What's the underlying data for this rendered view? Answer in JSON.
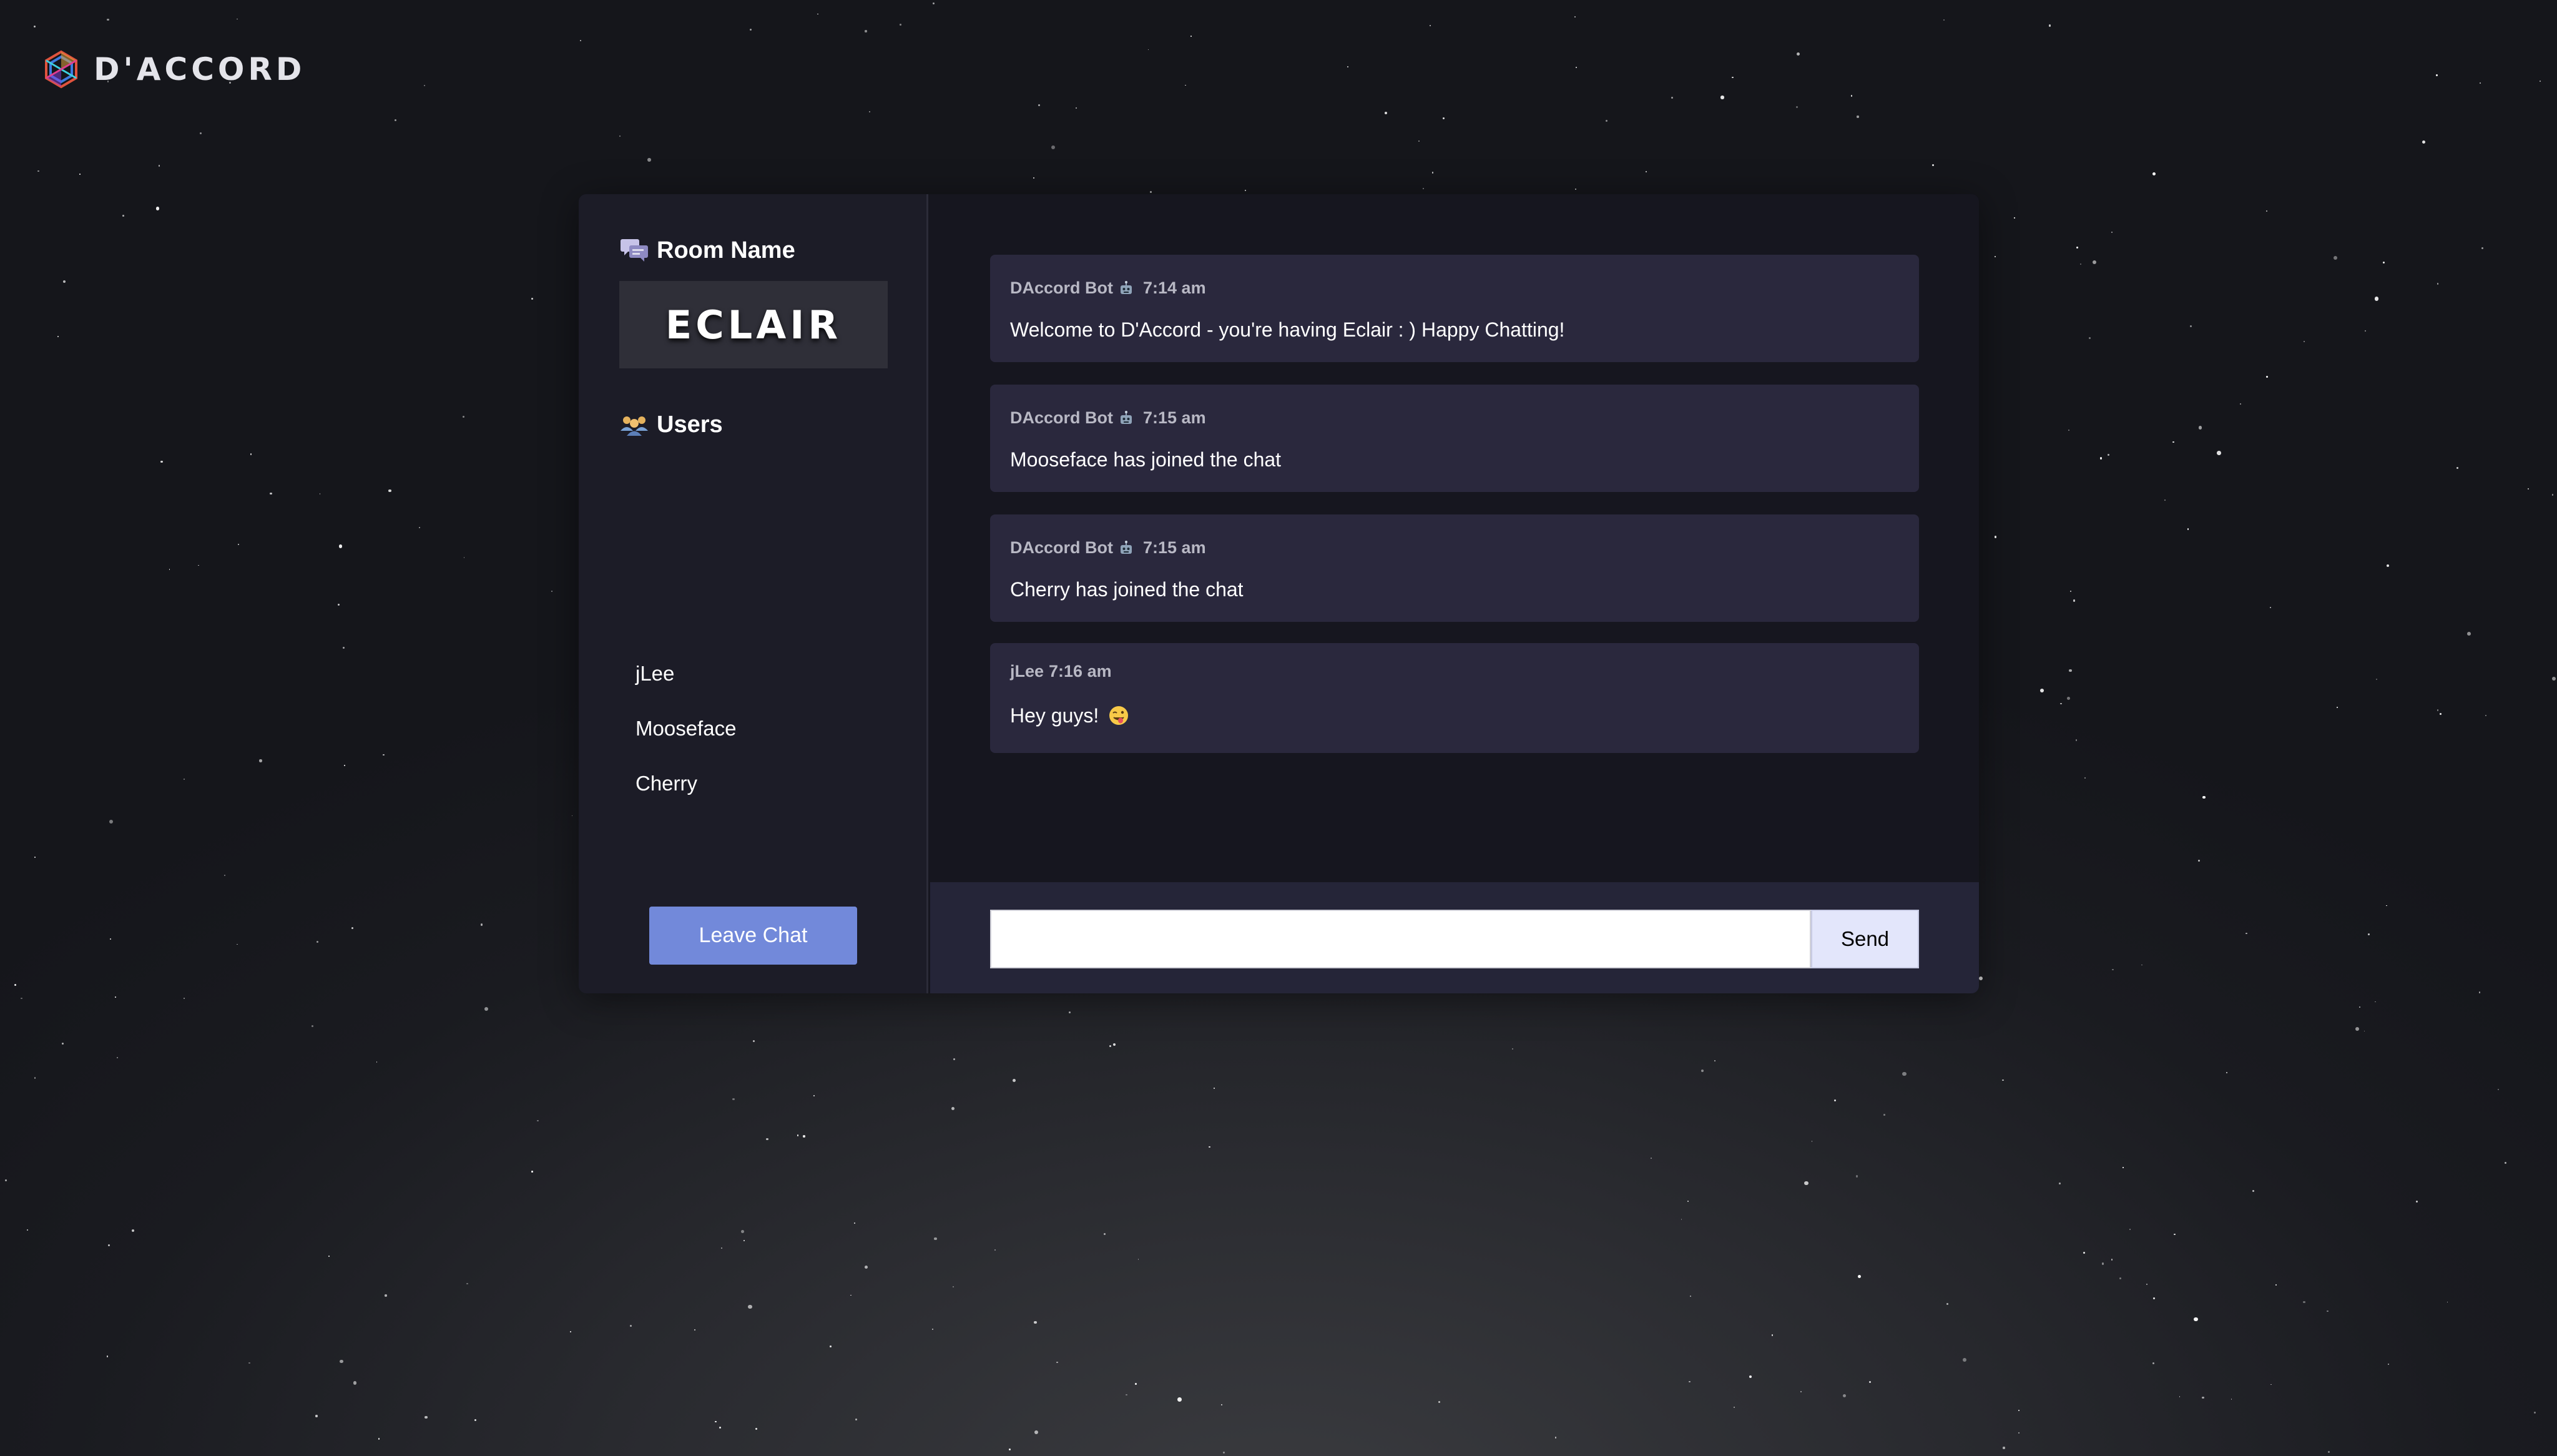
{
  "app": {
    "name": "D'ACCORD",
    "logo_icon": "hexagon-logo-icon"
  },
  "sidebar": {
    "room_heading": "Room Name",
    "room_heading_icon": "chat-bubbles-icon",
    "room_name": "ECLAIR",
    "users_heading": "Users",
    "users_heading_icon": "users-group-icon",
    "users": [
      "jLee",
      "Mooseface",
      "Cherry"
    ],
    "leave_label": "Leave Chat"
  },
  "messages": [
    {
      "author": "DAccord Bot",
      "is_bot": true,
      "bot_icon": "robot-icon",
      "time": "7:14 am",
      "text": "Welcome to D'Accord - you're having Eclair : ) Happy Chatting!"
    },
    {
      "author": "DAccord Bot",
      "is_bot": true,
      "bot_icon": "robot-icon",
      "time": "7:15 am",
      "text": "Mooseface has joined the chat"
    },
    {
      "author": "DAccord Bot",
      "is_bot": true,
      "bot_icon": "robot-icon",
      "time": "7:15 am",
      "text": "Cherry has joined the chat"
    },
    {
      "author": "jLee",
      "is_bot": false,
      "time": "7:16 am",
      "text": "Hey guys!",
      "emoji": "winking-tongue-face-icon"
    }
  ],
  "composer": {
    "value": "",
    "placeholder": "",
    "send_label": "Send"
  },
  "colors": {
    "accent": "#7289da",
    "card_bg": "#16161f",
    "sidebar_bg": "#1c1c27",
    "message_bg": "#2a283d",
    "composer_bg": "#252538",
    "send_bg": "#e3e6fb"
  }
}
